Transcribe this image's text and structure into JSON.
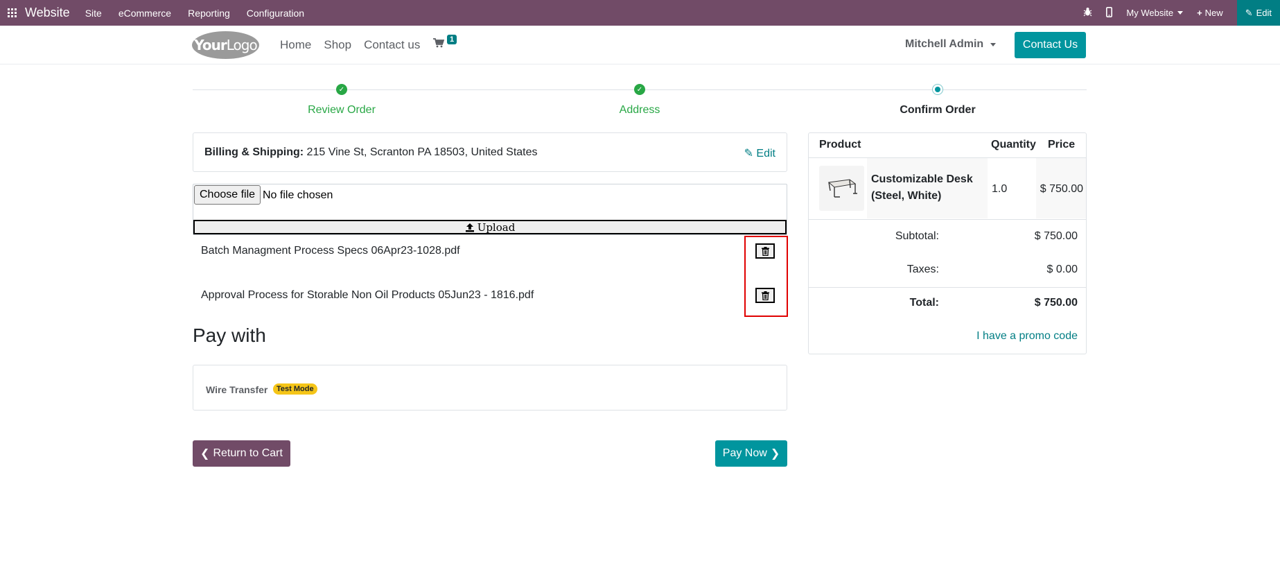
{
  "topbar": {
    "brand": "Website",
    "menu": [
      "Site",
      "eCommerce",
      "Reporting",
      "Configuration"
    ],
    "site_selector": "My Website",
    "new_label": "New",
    "edit_label": "Edit",
    "bg_color": "#714b67",
    "edit_bg_color": "#017e84"
  },
  "header": {
    "logo_text_bold": "Your",
    "logo_text": "Logo",
    "nav": [
      "Home",
      "Shop",
      "Contact us"
    ],
    "cart_count": "1",
    "user": "Mitchell Admin",
    "contact_button": "Contact Us",
    "accent_color": "#01959e"
  },
  "progress": {
    "steps": [
      {
        "label": "Review Order",
        "state": "done"
      },
      {
        "label": "Address",
        "state": "done"
      },
      {
        "label": "Confirm Order",
        "state": "current"
      }
    ]
  },
  "billing": {
    "label": "Billing & Shipping:",
    "address": "215 Vine St, Scranton PA 18503, United States",
    "edit_label": "Edit"
  },
  "upload": {
    "choose_label": "Choose file",
    "no_file_text": "No file chosen",
    "upload_label": "Upload"
  },
  "attachments": [
    {
      "name": "Batch Managment Process Specs 06Apr23-1028.pdf"
    },
    {
      "name": "Approval Process for Storable Non Oil Products 05Jun23 - 1816.pdf"
    }
  ],
  "payment": {
    "heading": "Pay with",
    "method": "Wire Transfer",
    "badge": "Test Mode",
    "return_label": "Return to Cart",
    "pay_label": "Pay Now"
  },
  "summary": {
    "headers": {
      "product": "Product",
      "quantity": "Quantity",
      "price": "Price"
    },
    "items": [
      {
        "name": "Customizable Desk (Steel, White)",
        "quantity": "1.0",
        "price": "$ 750.00"
      }
    ],
    "subtotal_label": "Subtotal:",
    "subtotal": "$ 750.00",
    "taxes_label": "Taxes:",
    "taxes": "$ 0.00",
    "total_label": "Total:",
    "total": "$ 750.00",
    "promo_label": "I have a promo code"
  }
}
